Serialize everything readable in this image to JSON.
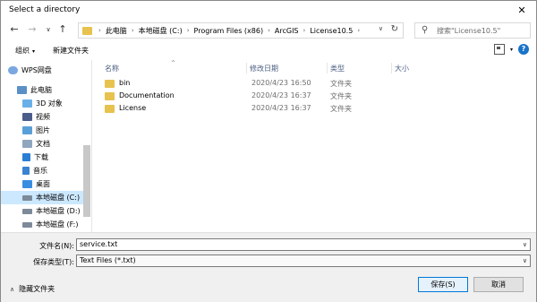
{
  "window": {
    "title": "Select a directory",
    "close_symbol": "✕"
  },
  "nav": {
    "back": "←",
    "forward": "→",
    "up_dropdown": "∨",
    "up": "↑",
    "breadcrumbs": [
      "此电脑",
      "本地磁盘 (C:)",
      "Program Files (x86)",
      "ArcGIS",
      "License10.5"
    ],
    "separator": "›",
    "search_placeholder": "搜索\"License10.5\"",
    "refresh": "↻",
    "address_dropdown": "∨"
  },
  "toolbar": {
    "organize": "组织",
    "organize_caret": "▾",
    "new_folder": "新建文件夹"
  },
  "sidebar": {
    "items": [
      {
        "label": "WPS网盘",
        "icon": "cloud-icon"
      },
      {
        "label": "此电脑",
        "icon": "computer-icon"
      },
      {
        "label": "3D 对象",
        "icon": "3d-objects-icon"
      },
      {
        "label": "视频",
        "icon": "video-icon"
      },
      {
        "label": "图片",
        "icon": "pictures-icon"
      },
      {
        "label": "文档",
        "icon": "documents-icon"
      },
      {
        "label": "下载",
        "icon": "download-icon"
      },
      {
        "label": "音乐",
        "icon": "music-icon"
      },
      {
        "label": "桌面",
        "icon": "desktop-icon"
      },
      {
        "label": "本地磁盘 (C:)",
        "icon": "drive-icon",
        "selected": true
      },
      {
        "label": "本地磁盘 (D:)",
        "icon": "drive-icon"
      },
      {
        "label": "本地磁盘 (F:)",
        "icon": "drive-icon"
      }
    ]
  },
  "columns": {
    "name": "名称",
    "date": "修改日期",
    "type": "类型",
    "size": "大小",
    "sort_caret": "^"
  },
  "files": [
    {
      "name": "bin",
      "date": "2020/4/23 16:50",
      "type": "文件夹"
    },
    {
      "name": "Documentation",
      "date": "2020/4/23 16:37",
      "type": "文件夹"
    },
    {
      "name": "License",
      "date": "2020/4/23 16:37",
      "type": "文件夹"
    }
  ],
  "bottom": {
    "filename_label": "文件名(N):",
    "filename_value": "service.txt",
    "filetype_label": "保存类型(T):",
    "filetype_value": "Text Files (*.txt)",
    "dropdown_symbol": "∨",
    "hide_folders": "隐藏文件夹",
    "hide_caret": "∧",
    "save": "保存(S)",
    "cancel": "取消"
  },
  "colors": {
    "selected_bg": "#cce8ff",
    "folder": "#e8c24e",
    "accent": "#0078d7"
  }
}
